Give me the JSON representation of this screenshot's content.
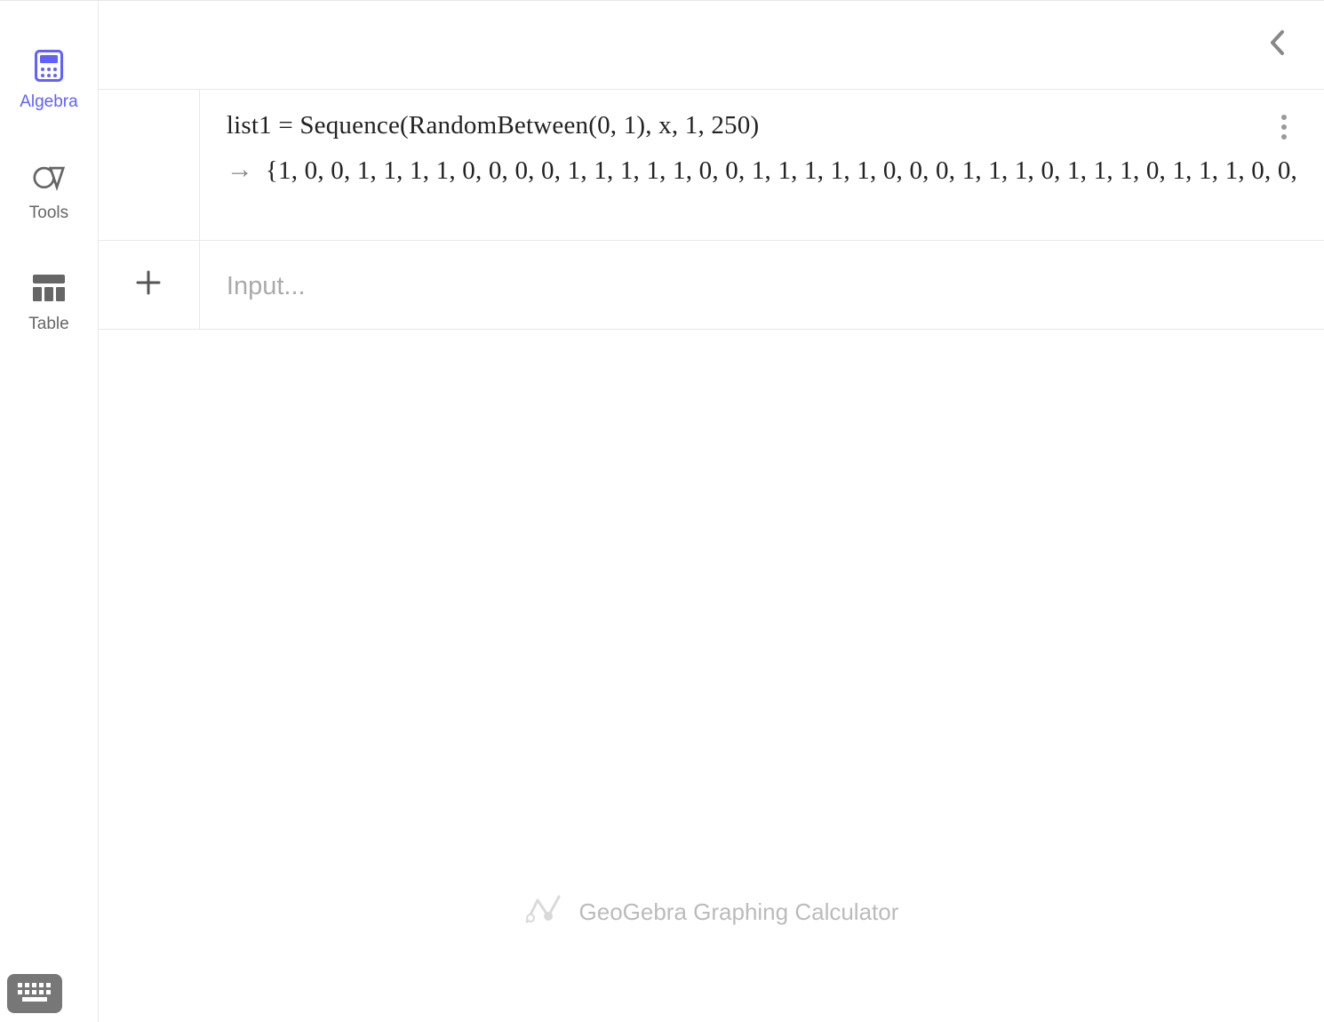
{
  "sidebar": {
    "items": [
      {
        "label": "Algebra"
      },
      {
        "label": "Tools"
      },
      {
        "label": "Table"
      }
    ]
  },
  "rows": {
    "expression": {
      "name": "list1",
      "formula": "Sequence(RandomBetween(0, 1), x, 1, 250)",
      "display": "list1  =  Sequence(RandomBetween(0, 1), x, 1, 250)",
      "output_values": [
        1,
        0,
        0,
        1,
        1,
        1,
        1,
        0,
        0,
        0,
        0,
        1,
        1,
        1,
        1,
        1,
        0,
        0,
        1,
        1,
        1,
        1,
        1,
        0,
        0,
        0,
        1,
        1,
        1,
        0,
        1,
        1,
        1,
        0,
        1,
        1,
        1,
        0,
        0
      ],
      "output_display": "{1, 0, 0, 1, 1, 1, 1, 0, 0, 0, 0, 1, 1, 1, 1, 1, 0, 0, 1, 1, 1, 1, 1, 0, 0, 0, 1, 1, 1, 0, 1, 1, 1, 0, 1, 1, 1, 0, 0,"
    },
    "input": {
      "placeholder": "Input..."
    }
  },
  "watermark": {
    "text": "GeoGebra Graphing Calculator"
  }
}
